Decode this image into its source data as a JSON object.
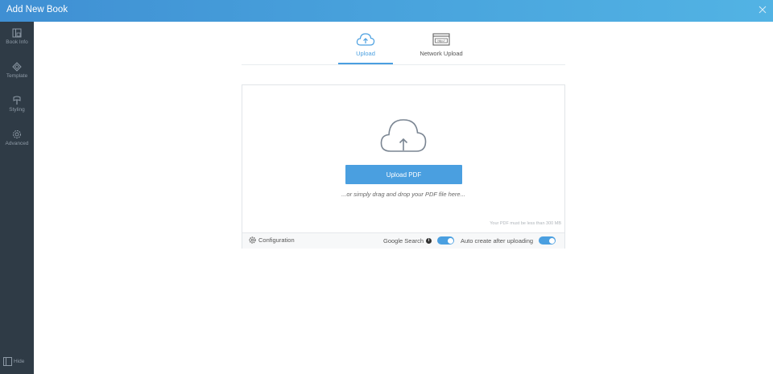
{
  "window": {
    "title": "Add New Book"
  },
  "sidebar": {
    "items": [
      {
        "label": "Book Info",
        "icon": "book-icon"
      },
      {
        "label": "Template",
        "icon": "template-icon"
      },
      {
        "label": "Styling",
        "icon": "palette-icon"
      },
      {
        "label": "Advanced",
        "icon": "gear-icon"
      }
    ],
    "hide_label": "Hide"
  },
  "tabs": [
    {
      "label": "Upload",
      "icon": "cloud-upload-icon",
      "active": true
    },
    {
      "label": "Network Upload",
      "icon": "browser-http-icon",
      "icon_text": "http://",
      "active": false
    }
  ],
  "upload": {
    "button_label": "Upload PDF",
    "drag_text": "...or simply drag and drop your PDF file here...",
    "size_note": "Your PDF must be less than 300 MB"
  },
  "config_bar": {
    "configuration_label": "Configuration",
    "google_search_label": "Google Search",
    "google_search_on": true,
    "auto_create_label": "Auto create after uploading",
    "auto_create_on": true
  },
  "colors": {
    "accent": "#4a9fe0",
    "sidebar": "#2f3b46",
    "titlebar": "#4aa6de"
  }
}
